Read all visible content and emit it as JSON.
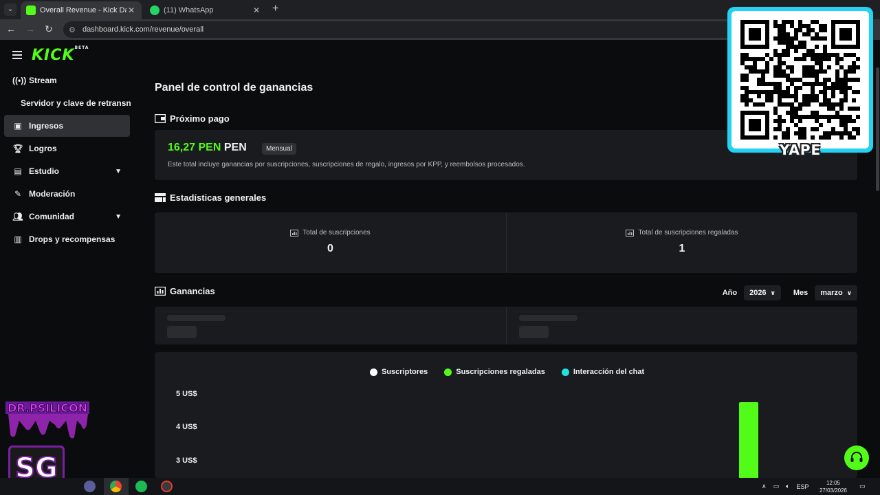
{
  "browser": {
    "tabs": [
      {
        "title": "Overall Revenue - Kick Dashbo",
        "active": true
      },
      {
        "title": "(11) WhatsApp",
        "active": false
      }
    ],
    "url": "dashboard.kick.com/revenue/overall"
  },
  "sidebar": {
    "logo": "KICK",
    "logo_badge": "BETA",
    "items": [
      {
        "label": "Stream",
        "icon": "broadcast-icon"
      },
      {
        "label": "Servidor y clave de retransn",
        "icon": ""
      },
      {
        "label": "Ingresos",
        "icon": "wallet-icon",
        "active": true
      },
      {
        "label": "Logros",
        "icon": "trophy-icon"
      },
      {
        "label": "Estudio",
        "icon": "studio-icon",
        "expandable": true
      },
      {
        "label": "Moderación",
        "icon": "wrench-icon"
      },
      {
        "label": "Comunidad",
        "icon": "people-icon",
        "expandable": true
      },
      {
        "label": "Drops y recompensas",
        "icon": "gift-icon"
      }
    ]
  },
  "page": {
    "title": "Panel de control de ganancias",
    "next_payout": {
      "heading": "Próximo pago",
      "amount": "16,27 PEN",
      "currency": "PEN",
      "badge": "Mensual",
      "description": "Este total incluye ganancias por suscripciones, suscripciones de regalo, ingresos por KPP, y reembolsos procesados."
    },
    "stats": {
      "heading": "Estadísticas generales",
      "total_subs_label": "Total de suscripciones",
      "total_subs_value": "0",
      "total_gifted_label": "Total de suscripciones regaladas",
      "total_gifted_value": "1"
    },
    "earnings": {
      "heading": "Ganancias",
      "year_label": "Año",
      "year_value": "2026",
      "month_label": "Mes",
      "month_value": "marzo"
    }
  },
  "chart_data": {
    "type": "bar",
    "series": [
      {
        "name": "Suscriptores",
        "color": "#ffffff"
      },
      {
        "name": "Suscripciones regaladas",
        "color": "#53fc18"
      },
      {
        "name": "Interacción del chat",
        "color": "#22e0e0"
      }
    ],
    "yticks": [
      "5 US$",
      "4 US$",
      "3 US$"
    ],
    "visible_bar": {
      "series": "Suscripciones regaladas",
      "value_usd": 4.8
    },
    "y_visible_range": [
      2.5,
      5.0
    ]
  },
  "overlay": {
    "qr_label": "YAPE"
  },
  "taskbar": {
    "lang": "ESP",
    "time": "12:05",
    "date": "27/03/2026"
  },
  "colors": {
    "accent": "#53fc18",
    "card": "#191b1f",
    "background": "#0b0c0d"
  }
}
